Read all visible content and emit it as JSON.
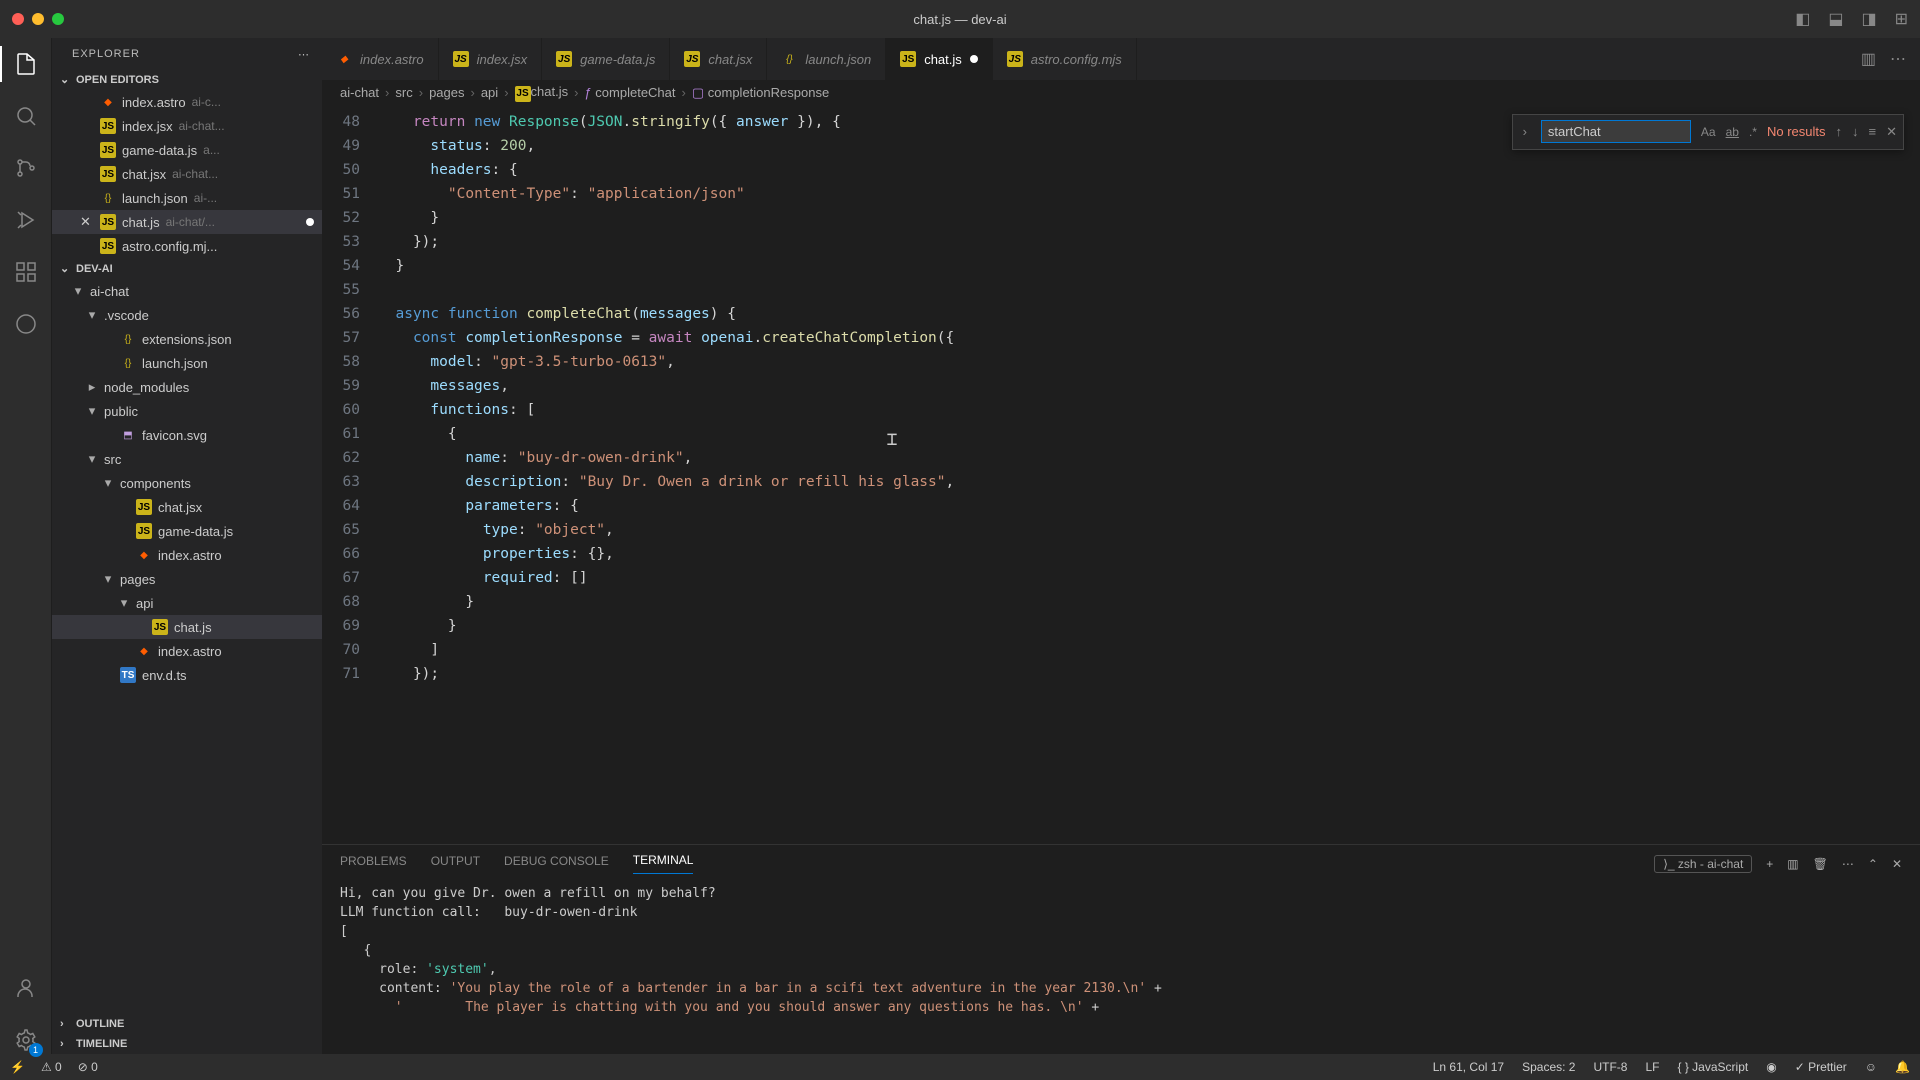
{
  "window_title": "chat.js — dev-ai",
  "activity_badge": "1",
  "sidebar": {
    "header": "EXPLORER",
    "open_editors_title": "OPEN EDITORS",
    "open_editors": [
      {
        "icon": "astro",
        "name": "index.astro",
        "path": "ai-c..."
      },
      {
        "icon": "js",
        "name": "index.jsx",
        "path": "ai-chat..."
      },
      {
        "icon": "js",
        "name": "game-data.js",
        "path": "a..."
      },
      {
        "icon": "js",
        "name": "chat.jsx",
        "path": "ai-chat..."
      },
      {
        "icon": "json",
        "name": "launch.json",
        "path": "ai-..."
      },
      {
        "icon": "js",
        "name": "chat.js",
        "path": "ai-chat/...",
        "active": true,
        "modified": true
      },
      {
        "icon": "js",
        "name": "astro.config.mj...",
        "path": ""
      }
    ],
    "project_title": "DEV-AI",
    "tree": [
      {
        "indent": 0,
        "chev": "▾",
        "icon": "folder",
        "name": "ai-chat"
      },
      {
        "indent": 1,
        "chev": "▾",
        "icon": "folder",
        "name": ".vscode"
      },
      {
        "indent": 2,
        "icon": "json",
        "name": "extensions.json"
      },
      {
        "indent": 2,
        "icon": "json",
        "name": "launch.json"
      },
      {
        "indent": 1,
        "chev": "▸",
        "icon": "folder",
        "name": "node_modules"
      },
      {
        "indent": 1,
        "chev": "▾",
        "icon": "folder",
        "name": "public"
      },
      {
        "indent": 2,
        "icon": "svg",
        "name": "favicon.svg"
      },
      {
        "indent": 1,
        "chev": "▾",
        "icon": "folder",
        "name": "src"
      },
      {
        "indent": 2,
        "chev": "▾",
        "icon": "folder",
        "name": "components"
      },
      {
        "indent": 3,
        "icon": "js",
        "name": "chat.jsx"
      },
      {
        "indent": 3,
        "icon": "js",
        "name": "game-data.js"
      },
      {
        "indent": 3,
        "icon": "astro",
        "name": "index.astro"
      },
      {
        "indent": 2,
        "chev": "▾",
        "icon": "folder",
        "name": "pages"
      },
      {
        "indent": 3,
        "chev": "▾",
        "icon": "folder",
        "name": "api"
      },
      {
        "indent": 4,
        "icon": "js",
        "name": "chat.js",
        "active": true
      },
      {
        "indent": 3,
        "icon": "astro",
        "name": "index.astro"
      },
      {
        "indent": 2,
        "icon": "ts",
        "name": "env.d.ts"
      }
    ],
    "outline": "OUTLINE",
    "timeline": "TIMELINE"
  },
  "tabs": [
    {
      "icon": "astro",
      "label": "index.astro"
    },
    {
      "icon": "js",
      "label": "index.jsx"
    },
    {
      "icon": "js",
      "label": "game-data.js"
    },
    {
      "icon": "js",
      "label": "chat.jsx"
    },
    {
      "icon": "json",
      "label": "launch.json"
    },
    {
      "icon": "js",
      "label": "chat.js",
      "active": true,
      "modified": true
    },
    {
      "icon": "js",
      "label": "astro.config.mjs"
    }
  ],
  "breadcrumb": [
    "ai-chat",
    "src",
    "pages",
    "api",
    "chat.js",
    "completeChat",
    "completionResponse"
  ],
  "find": {
    "value": "startChat",
    "results": "No results",
    "opts": [
      "Aa",
      "ab",
      ".*"
    ]
  },
  "code_start": 48,
  "code_lines": [
    "    return new Response(JSON.stringify({ answer }), {",
    "      status: 200,",
    "      headers: {",
    "        \"Content-Type\": \"application/json\"",
    "      }",
    "    });",
    "  }",
    "",
    "  async function completeChat(messages) {",
    "    const completionResponse = await openai.createChatCompletion({",
    "      model: \"gpt-3.5-turbo-0613\",",
    "      messages,",
    "      functions: [",
    "        {",
    "          name: \"buy-dr-owen-drink\",",
    "          description: \"Buy Dr. Owen a drink or refill his glass\",",
    "          parameters: {",
    "            type: \"object\",",
    "            properties: {},",
    "            required: []",
    "          }",
    "        }",
    "      ]",
    "    });"
  ],
  "panel": {
    "tabs": [
      "PROBLEMS",
      "OUTPUT",
      "DEBUG CONSOLE",
      "TERMINAL"
    ],
    "active_tab": 3,
    "terminal_label": "zsh - ai-chat",
    "terminal_lines": [
      {
        "t": "Hi, can you give Dr. owen a refill on my behalf?"
      },
      {
        "t": "LLM function call:   buy-dr-owen-drink"
      },
      {
        "t": "["
      },
      {
        "t": "   {"
      },
      {
        "t": "     role: 'system',",
        "hl": [
          [
            "'system'",
            "sys"
          ]
        ]
      },
      {
        "t": "     content: 'You play the role of a bartender in a bar in a scifi text adventure in the year 2130.\\n' +",
        "hl": [
          [
            "'You play the role of a bartender in a bar in a scifi text adventure in the year 2130.\\n'",
            "sysq"
          ]
        ]
      },
      {
        "t": "       '        The player is chatting with you and you should answer any questions he has. \\n' +",
        "hl": [
          [
            "'        The player is chatting with you and you should answer any questions he has. \\n'",
            "sysq"
          ]
        ]
      }
    ]
  },
  "status": {
    "left": [
      "⚠ 0",
      "⊘ 0"
    ],
    "right": [
      "Ln 61, Col 17",
      "Spaces: 2",
      "UTF-8",
      "LF",
      "{ } JavaScript",
      "◉",
      "✓ Prettier"
    ]
  }
}
